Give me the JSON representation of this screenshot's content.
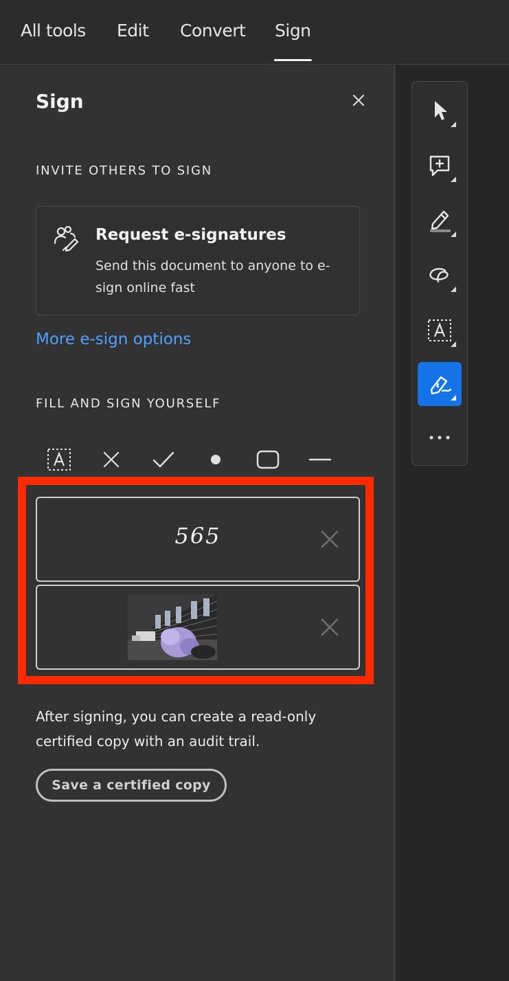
{
  "tabs": [
    {
      "label": "All tools"
    },
    {
      "label": "Edit"
    },
    {
      "label": "Convert"
    },
    {
      "label": "Sign",
      "active": true
    }
  ],
  "panel": {
    "title": "Sign",
    "invite_heading": "INVITE OTHERS TO SIGN",
    "request_card": {
      "title": "Request e-signatures",
      "description": "Send this document to anyone to e-sign online fast",
      "icon": "request-signatures-icon"
    },
    "more_link": "More e-sign options",
    "fill_heading": "FILL AND SIGN YOURSELF",
    "fill_tools": [
      {
        "name": "add-text-icon"
      },
      {
        "name": "cross-mark-icon"
      },
      {
        "name": "checkmark-icon"
      },
      {
        "name": "dot-icon"
      },
      {
        "name": "rounded-rectangle-icon"
      },
      {
        "name": "line-icon"
      }
    ],
    "signatures": [
      {
        "type": "text",
        "value": "565"
      },
      {
        "type": "image",
        "value": ""
      }
    ],
    "info_text": "After signing, you can create a read-only certified copy with an audit trail.",
    "save_button": "Save a certified copy"
  },
  "rail": [
    {
      "name": "select-cursor-icon"
    },
    {
      "name": "add-comment-icon"
    },
    {
      "name": "highlight-pen-icon"
    },
    {
      "name": "freehand-draw-icon"
    },
    {
      "name": "text-box-icon"
    },
    {
      "name": "sign-pen-icon",
      "active": true
    },
    {
      "name": "more-options-icon"
    }
  ],
  "colors": {
    "accent": "#1473e6",
    "link": "#4ea0ff",
    "highlight": "#ff2a00"
  }
}
